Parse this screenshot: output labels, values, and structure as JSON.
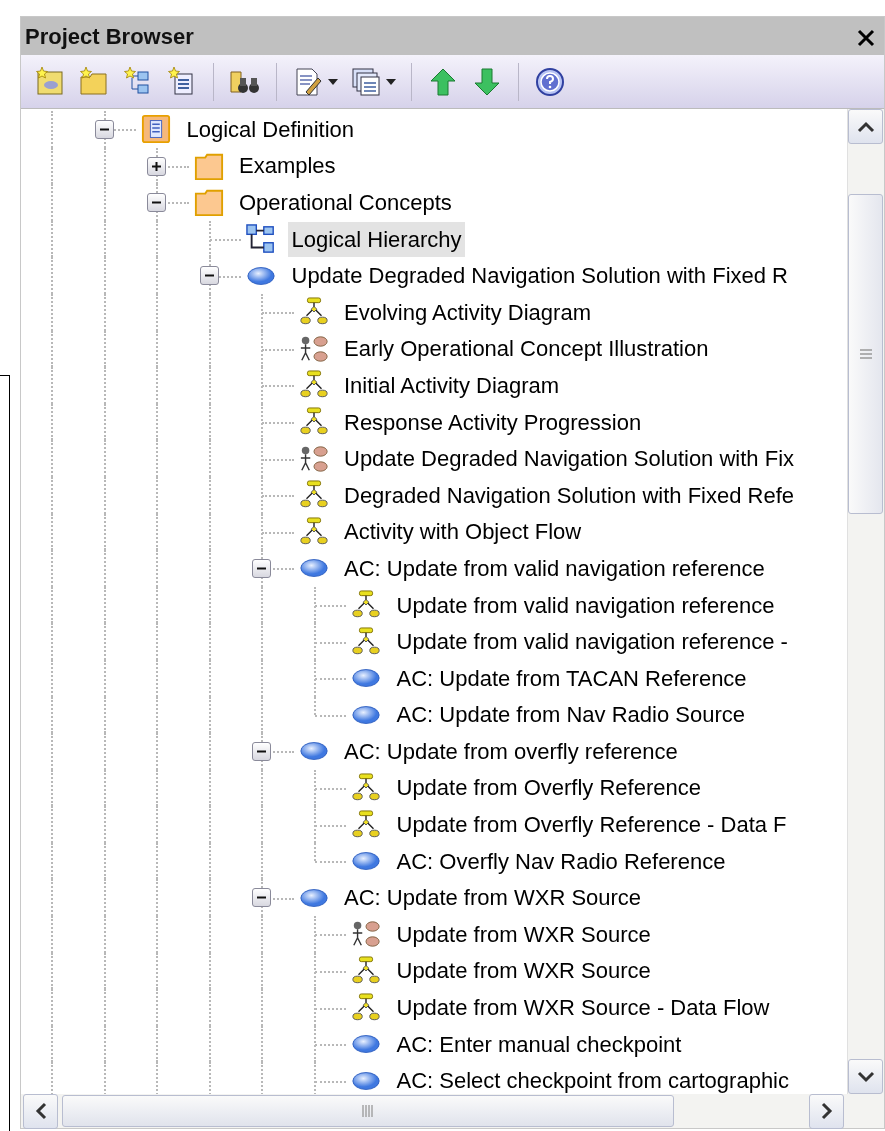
{
  "title": "Project Browser",
  "tree": [
    {
      "label": "Logical Definition",
      "kind": "package",
      "expanded": true,
      "selected": false,
      "children": [
        {
          "label": "Examples",
          "kind": "folder",
          "expanded": false,
          "selected": false
        },
        {
          "label": "Operational Concepts",
          "kind": "folder",
          "expanded": true,
          "selected": false,
          "children": [
            {
              "label": "Logical Hierarchy",
              "kind": "hierarchy",
              "selected": true
            },
            {
              "label": "Update Degraded Navigation Solution with Fixed R",
              "kind": "usecase",
              "expanded": true,
              "selected": false,
              "children": [
                {
                  "label": "Evolving Activity Diagram",
                  "kind": "activity",
                  "selected": false
                },
                {
                  "label": "Early Operational Concept Illustration",
                  "kind": "usecase-diagram",
                  "selected": false
                },
                {
                  "label": "Initial Activity Diagram",
                  "kind": "activity",
                  "selected": false
                },
                {
                  "label": "Response Activity Progression",
                  "kind": "activity",
                  "selected": false
                },
                {
                  "label": "Update Degraded Navigation Solution with Fix",
                  "kind": "usecase-diagram",
                  "selected": false
                },
                {
                  "label": "Degraded Navigation Solution with Fixed Refe",
                  "kind": "activity",
                  "selected": false
                },
                {
                  "label": "Activity with Object Flow",
                  "kind": "activity",
                  "selected": false
                },
                {
                  "label": "AC: Update from valid navigation reference",
                  "kind": "usecase",
                  "expanded": true,
                  "selected": false,
                  "children": [
                    {
                      "label": "Update from valid navigation reference",
                      "kind": "activity",
                      "selected": false
                    },
                    {
                      "label": "Update from valid navigation reference -",
                      "kind": "activity",
                      "selected": false
                    },
                    {
                      "label": "AC: Update from TACAN Reference",
                      "kind": "usecase",
                      "selected": false
                    },
                    {
                      "label": "AC: Update from Nav Radio Source",
                      "kind": "usecase",
                      "selected": false
                    }
                  ]
                },
                {
                  "label": "AC: Update from overfly reference",
                  "kind": "usecase",
                  "expanded": true,
                  "selected": false,
                  "children": [
                    {
                      "label": "Update from Overfly Reference",
                      "kind": "activity",
                      "selected": false
                    },
                    {
                      "label": "Update from Overfly Reference - Data F",
                      "kind": "activity",
                      "selected": false
                    },
                    {
                      "label": "AC: Overfly Nav Radio Reference",
                      "kind": "usecase",
                      "selected": false
                    }
                  ]
                },
                {
                  "label": "AC: Update from WXR Source",
                  "kind": "usecase",
                  "expanded": true,
                  "selected": false,
                  "children": [
                    {
                      "label": "Update from WXR Source",
                      "kind": "usecase-diagram",
                      "selected": false
                    },
                    {
                      "label": "Update from WXR Source",
                      "kind": "activity",
                      "selected": false
                    },
                    {
                      "label": "Update from WXR Source - Data Flow",
                      "kind": "activity",
                      "selected": false
                    },
                    {
                      "label": "AC: Enter manual checkpoint",
                      "kind": "usecase",
                      "selected": false
                    },
                    {
                      "label": "AC: Select checkpoint from cartographic",
                      "kind": "usecase",
                      "selected": false
                    }
                  ]
                }
              ]
            }
          ]
        }
      ]
    }
  ]
}
